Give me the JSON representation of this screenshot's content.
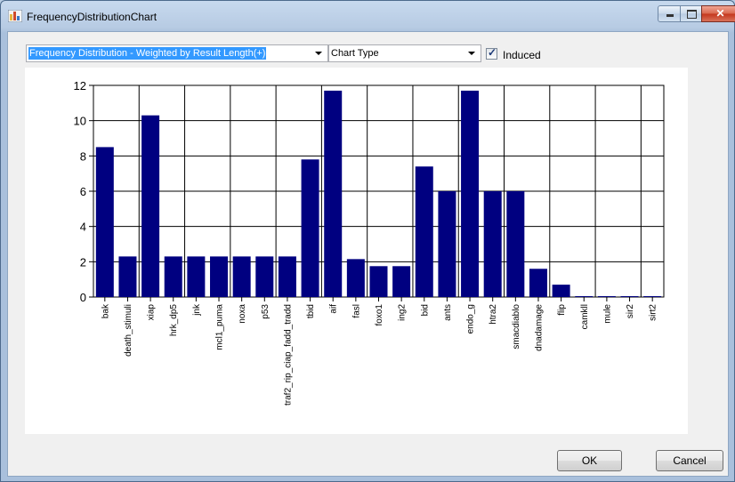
{
  "window": {
    "title": "FrequencyDistributionChart"
  },
  "toolbar": {
    "distribution_select": "Frequency Distribution - Weighted by Result Length(+)",
    "chart_type_select": "Chart Type",
    "induced_label": "Induced",
    "induced_checked": true
  },
  "buttons": {
    "ok": "OK",
    "cancel": "Cancel"
  },
  "chart_data": {
    "type": "bar",
    "categories": [
      "bak",
      "death_stimuli",
      "xiap",
      "hrk_dp5",
      "jnk",
      "mcl1_puma",
      "noxa",
      "p53",
      "traf2_rip_ciap_fadd_tradd",
      "tbid",
      "aif",
      "fasl",
      "foxo1",
      "ing2",
      "bid",
      "ants",
      "endo_g",
      "htra2",
      "smacdiablo",
      "dnadamage",
      "flip",
      "camkll",
      "mule",
      "sir2",
      "sirt2"
    ],
    "values": [
      8.5,
      2.3,
      10.3,
      2.3,
      2.3,
      2.3,
      2.3,
      2.3,
      2.3,
      7.8,
      11.7,
      2.15,
      1.75,
      1.75,
      7.4,
      6.0,
      11.7,
      6.0,
      6.0,
      1.6,
      0.7,
      0.05,
      0.05,
      0.05,
      0.05
    ],
    "ylim": [
      0,
      12
    ],
    "yticks": [
      "0",
      "2",
      "4",
      "6",
      "8",
      "10",
      "12"
    ],
    "grid": true,
    "bar_color": "#000080"
  }
}
